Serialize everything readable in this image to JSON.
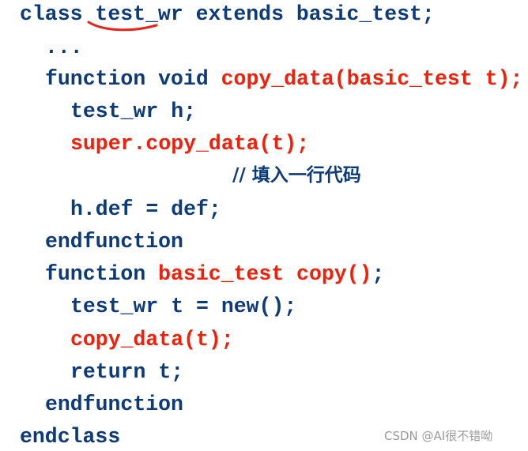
{
  "colors": {
    "keyword_blue": "#0d3a78",
    "highlight_red": "#f0200a",
    "annotation_red": "#e8231a",
    "watermark_gray": "#9a9a9a"
  },
  "code": {
    "line1": {
      "a": "class ",
      "b": "test_wr",
      "c": " extends basic_test;"
    },
    "line2": "...",
    "line3": {
      "a": "function void ",
      "b": "copy_data(basic_test t);"
    },
    "line4": "test_wr h;",
    "line5": "super.copy_data(t);",
    "comment": "// 填入一行代码",
    "line7": "h.def = def;",
    "line8": "endfunction",
    "line9": {
      "a": "function ",
      "b": "basic_test copy()",
      "c": ";"
    },
    "line10": "test_wr t = new();",
    "line11": "copy_data(t);",
    "line12": "return t;",
    "line13": "endfunction",
    "line14": "endclass"
  },
  "annotation": {
    "icon": "handwritten-underline-icon"
  },
  "watermark": "CSDN @AI很不错呦"
}
